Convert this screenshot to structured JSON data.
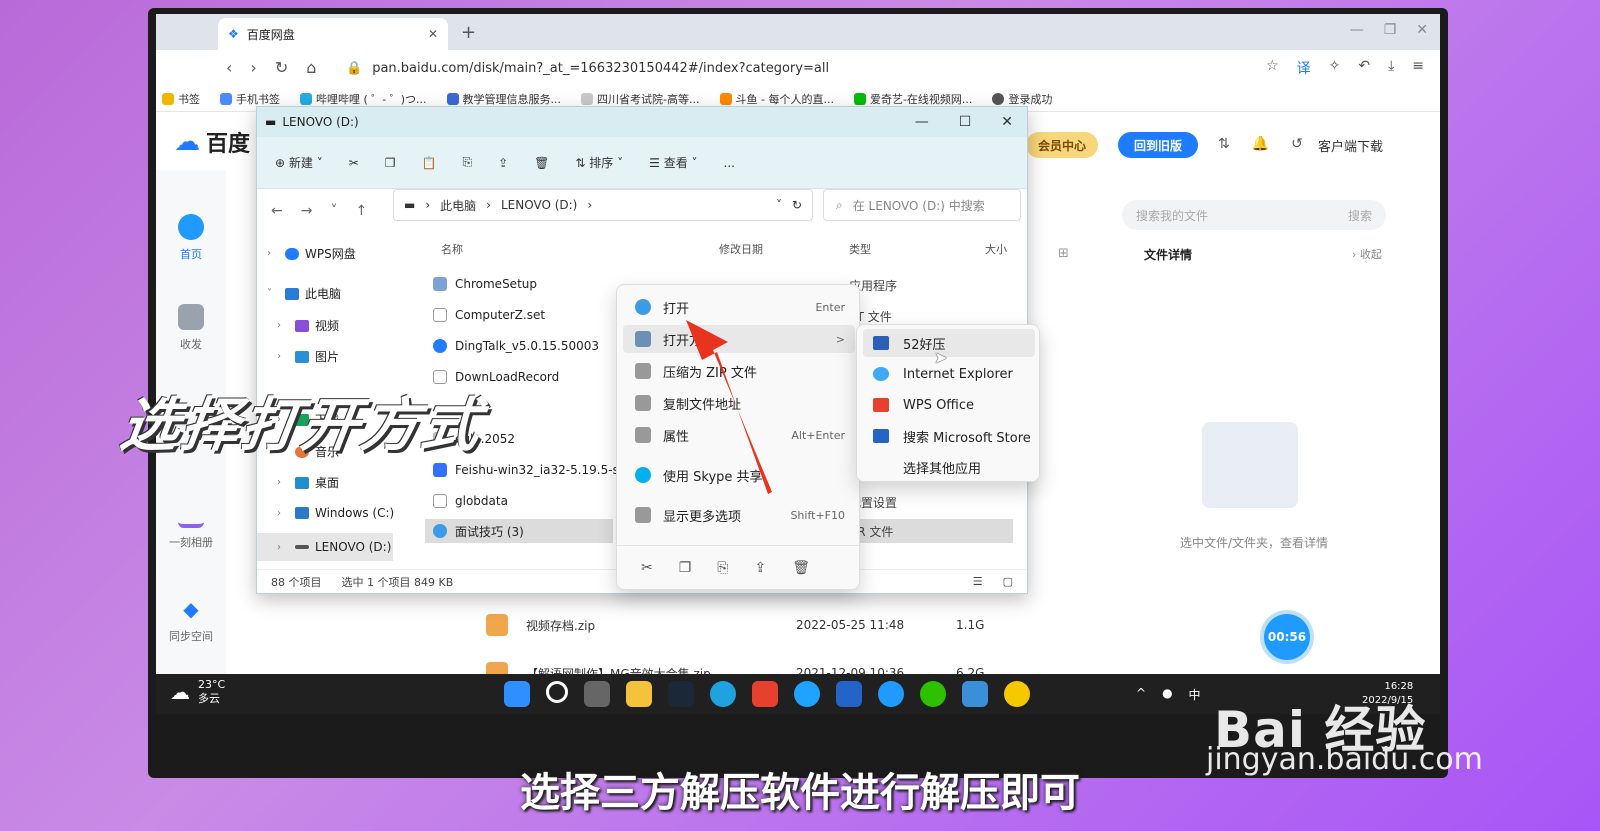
{
  "browser": {
    "tab_title": "百度网盘",
    "url": "pan.baidu.com/disk/main?_at_=1663230150442#/index?category=all",
    "bookmarks": [
      "书签",
      "手机书签",
      "哔哩哔哩 ( ゜- ゜)つ...",
      "教学管理信息服务...",
      "四川省考试院-高等...",
      "斗鱼 - 每个人的直...",
      "爱奇艺-在线视频网...",
      "登录成功"
    ]
  },
  "baidu": {
    "logo_text": "百度",
    "vip_label": "会员中心",
    "old_version_label": "回到旧版",
    "client_download": "客户端下载",
    "sidebar": [
      "首页",
      "收发",
      "一刻相册",
      "同步空间"
    ],
    "search_placeholder": "搜索我的文件",
    "search_button": "搜索",
    "details_title": "文件详情",
    "details_collapse": "收起",
    "details_hint": "选中文件/文件夹，查看详情",
    "files": [
      {
        "name": "视频存档.zip",
        "date": "2022-05-25 11:48",
        "size": "1.1G"
      },
      {
        "name": "【解语网制作】MG音效大合集.zip",
        "date": "2021-12-09 10:36",
        "size": "6.2G"
      }
    ],
    "timer": "00:56"
  },
  "explorer": {
    "title": "LENOVO (D:)",
    "toolbar": {
      "new": "新建",
      "sort": "排序",
      "view": "查看",
      "more": "..."
    },
    "breadcrumb": [
      "此电脑",
      "LENOVO (D:)"
    ],
    "search_placeholder": "在 LENOVO (D:) 中搜索",
    "tree": [
      "WPS网盘",
      "此电脑",
      "视频",
      "图片",
      "下载",
      "音乐",
      "桌面",
      "Windows (C:)",
      "LENOVO (D:)"
    ],
    "columns": {
      "name": "名称",
      "date": "修改日期",
      "type": "类型",
      "size": "大小"
    },
    "files": [
      "ChromeSetup",
      "ComputerZ.set",
      "DingTalk_v5.0.15.50003",
      "DownLoadRecord",
      "eula.2052",
      "Feishu-win32_ia32-5.19.5-sig",
      "globdata",
      "面试技巧 (3)"
    ],
    "partial_types": [
      "应用程序",
      "ET 文件",
      "配置设置",
      "AR 文件"
    ],
    "status": {
      "count": "88 个项目",
      "selected": "选中 1 个项目  849 KB"
    }
  },
  "context_menu": {
    "items": [
      {
        "label": "打开",
        "shortcut": "Enter"
      },
      {
        "label": "打开方式",
        "shortcut": ">"
      },
      {
        "label": "压缩为 ZIP 文件",
        "shortcut": ""
      },
      {
        "label": "复制文件地址",
        "shortcut": ""
      },
      {
        "label": "属性",
        "shortcut": "Alt+Enter"
      },
      {
        "label": "使用 Skype 共享",
        "shortcut": ""
      },
      {
        "label": "显示更多选项",
        "shortcut": "Shift+F10"
      }
    ],
    "submenu": [
      "52好压",
      "Internet Explorer",
      "WPS Office",
      "搜索 Microsoft Store",
      "选择其他应用"
    ]
  },
  "taskbar": {
    "temp": "23°C",
    "weather": "多云",
    "ime": "中",
    "time": "16:28",
    "date": "2022/9/15"
  },
  "overlay": {
    "title": "选择打开方式",
    "caption": "选择三方解压软件进行解压即可"
  },
  "watermark": {
    "brand": "Bai 经验",
    "site": "jingyan.baidu.com"
  }
}
